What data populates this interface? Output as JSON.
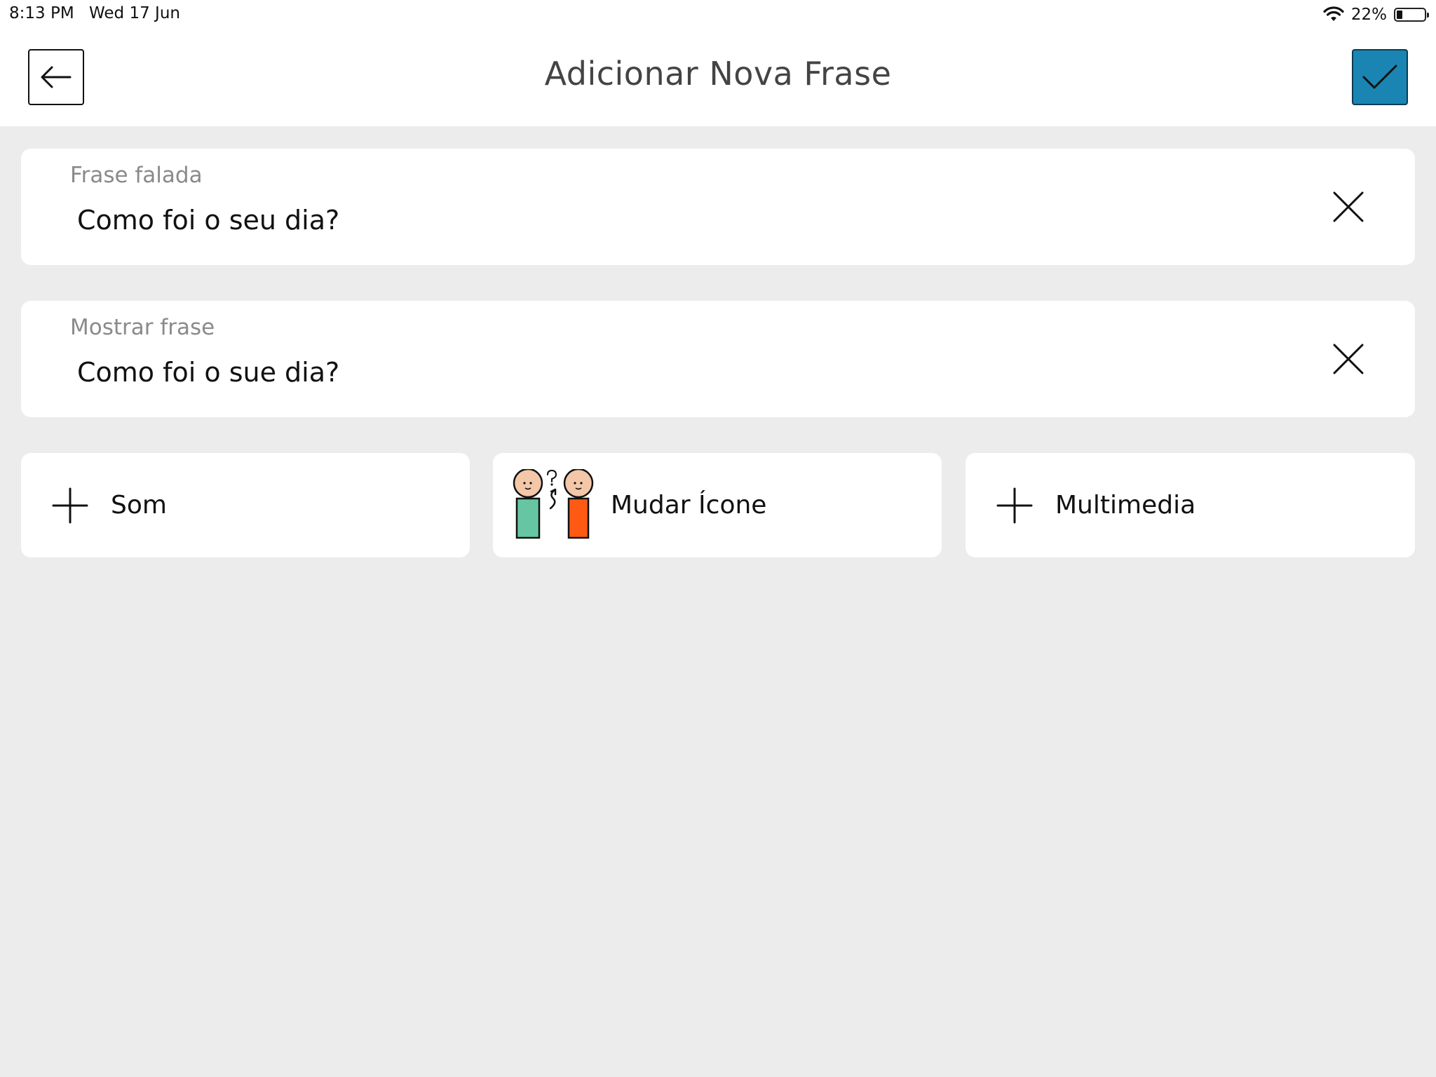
{
  "status_bar": {
    "time": "8:13 PM",
    "date": "Wed 17 Jun",
    "battery": "22%",
    "battery_level": 0.22
  },
  "header": {
    "title": "Adicionar Nova Frase",
    "back_icon": "arrow-left-icon",
    "confirm_icon": "checkmark-icon",
    "confirm_color": "#1a85b2"
  },
  "fields": {
    "spoken": {
      "label": "Frase falada",
      "value": "Como foi o seu dia?"
    },
    "display": {
      "label": "Mostrar frase",
      "value": "Como foi o sue dia?"
    }
  },
  "actions": {
    "sound_label": "Som",
    "change_icon_label": "Mudar Ícone",
    "media_label": "Multimedia"
  }
}
